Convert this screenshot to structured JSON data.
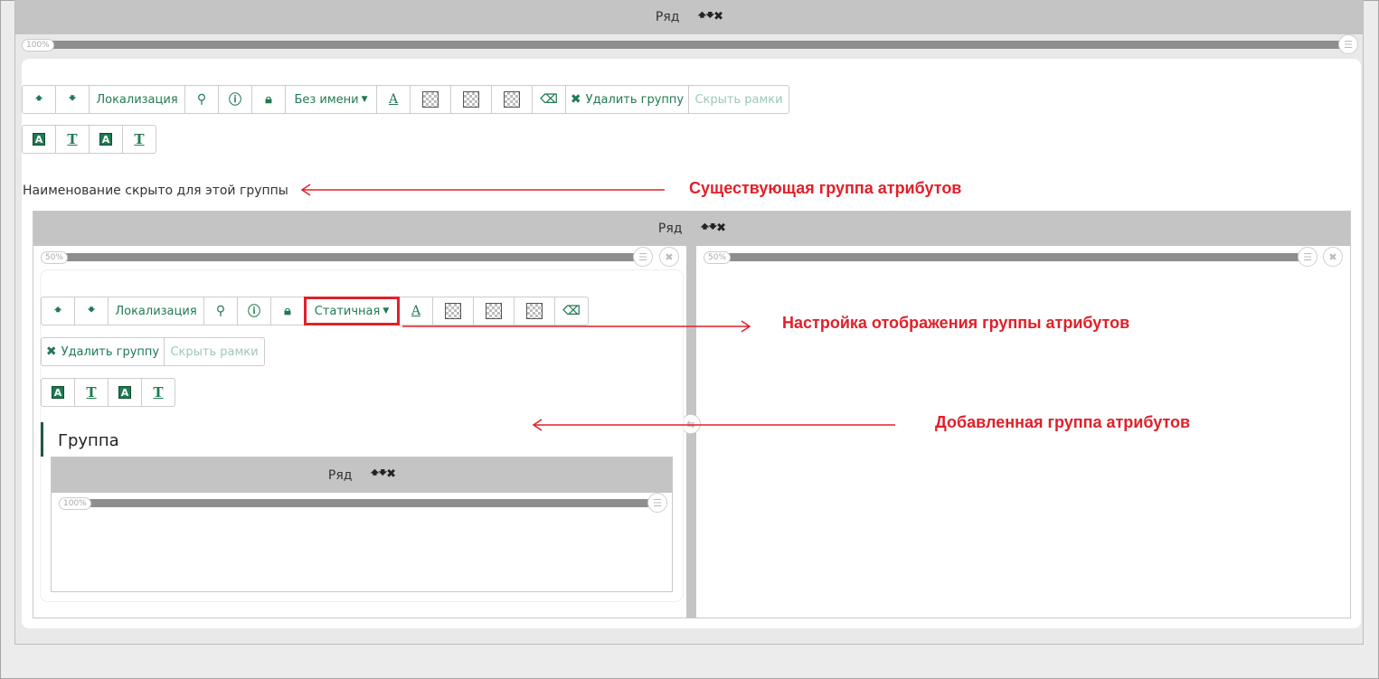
{
  "top_row": {
    "label": "Ряд",
    "controls": "🠹🠻✖",
    "percent": "100%"
  },
  "toolbar_outer": {
    "localization": "Локализация",
    "display_mode": "Без имени",
    "delete_group": "Удалить группу",
    "hide_frames": "Скрыть рамки"
  },
  "group_hidden_text": "Наименование скрыто для этой группы",
  "inner_row": {
    "label": "Ряд",
    "controls": "🠹🠻✖",
    "left_percent": "50%",
    "right_percent": "50%"
  },
  "toolbar_inner": {
    "localization": "Локализация",
    "display_mode": "Статичная",
    "delete_group": "Удалить группу",
    "hide_frames": "Скрыть рамки"
  },
  "added_group": {
    "title": "Группа",
    "row_label": "Ряд",
    "row_controls": "🠹🠻✖",
    "percent": "100%"
  },
  "annotations": {
    "existing": "Существующая группа атрибутов",
    "display_settings": "Настройка отображения группы атрибутов",
    "added": "Добавленная группа атрибутов"
  },
  "colors": {
    "accent": "#1f7a52",
    "annotation": "#e0202a",
    "row_bar": "#c4c4c4",
    "highlight_border": "#e0202a"
  }
}
